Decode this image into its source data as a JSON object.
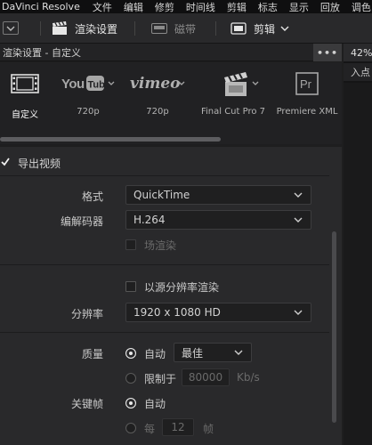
{
  "menubar": {
    "app": "DaVinci Resolve",
    "items": [
      "文件",
      "编辑",
      "修剪",
      "时间线",
      "剪辑",
      "标志",
      "显示",
      "回放",
      "调色"
    ]
  },
  "toolbar": {
    "render_settings_label": "渲染设置",
    "tape_label": "磁带",
    "clips_label": "剪辑"
  },
  "panel": {
    "title": "渲染设置 - 自定义",
    "more": "•••"
  },
  "right_strip": {
    "zoom": "42%",
    "in_point": "入点"
  },
  "presets": [
    {
      "logo": "custom",
      "caption": "自定义",
      "selected": true
    },
    {
      "logo": "YouTube",
      "caption": "720p",
      "selected": false
    },
    {
      "logo": "vimeo",
      "caption": "720p",
      "selected": false
    },
    {
      "logo": "finalcut",
      "caption": "Final Cut Pro 7",
      "selected": false
    },
    {
      "logo": "Pr",
      "caption": "Premiere XML",
      "selected": false
    }
  ],
  "settings": {
    "export_video_label": "导出视频",
    "export_video_checked": true,
    "format_label": "格式",
    "format_value": "QuickTime",
    "codec_label": "编解码器",
    "codec_value": "H.264",
    "field_render_label": "场渲染",
    "field_render_checked": false,
    "source_res_label": "以源分辨率渲染",
    "source_res_checked": false,
    "resolution_label": "分辨率",
    "resolution_value": "1920 x 1080 HD",
    "quality_label": "质量",
    "quality_auto_label": "自动",
    "quality_value": "最佳",
    "limit_label": "限制于",
    "limit_value": "80000",
    "limit_unit": "Kb/s",
    "keyframe_label": "关键帧",
    "keyframe_auto_label": "自动",
    "every_label": "每",
    "every_value": "12",
    "frames_label": "帧"
  }
}
